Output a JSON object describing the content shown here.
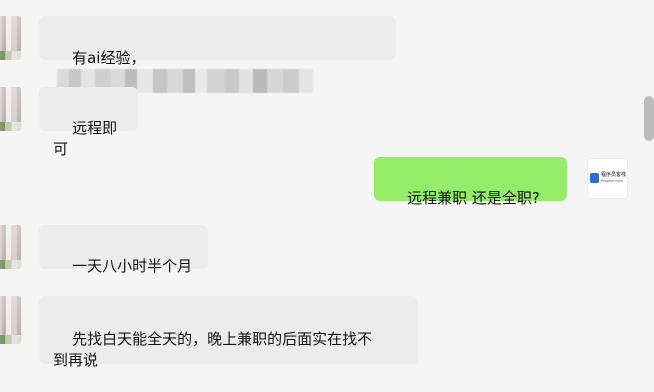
{
  "messages": [
    {
      "side": "left",
      "text_prefix": "有ai经验，",
      "has_redacted_content": true
    },
    {
      "side": "left",
      "text": "远程即可"
    },
    {
      "side": "right",
      "text": "远程兼职 还是全职?"
    },
    {
      "side": "left",
      "text": "一天八小时半个月"
    },
    {
      "side": "left",
      "text": "先找白天能全天的，晚上兼职的后面实在找不\n到再说"
    }
  ],
  "avatar": {
    "brand_line_1": "程序员客栈",
    "brand_line_2": "Proginn.com"
  },
  "colors": {
    "background": "#f5f5f5",
    "incoming_bubble": "#ececec",
    "outgoing_bubble": "#95ec69",
    "brand_blue": "#2f6bd6"
  }
}
